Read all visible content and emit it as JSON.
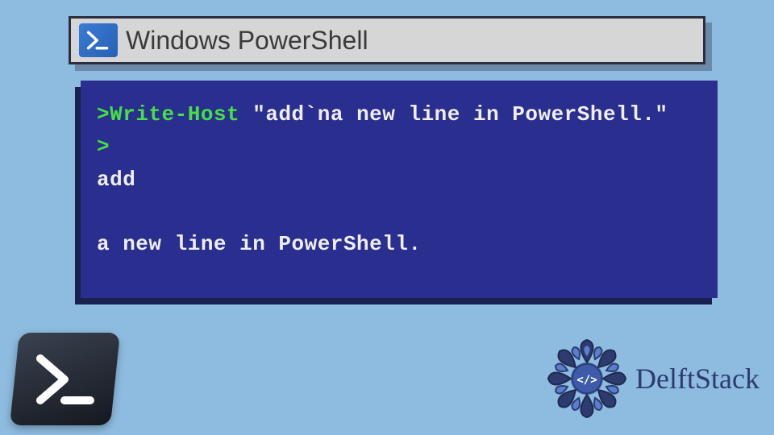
{
  "window": {
    "title": "Windows PowerShell"
  },
  "terminal": {
    "prompt1": ">",
    "command": "Write-Host",
    "string": " \"add`na new line in PowerShell.\"",
    "prompt2": ">",
    "out1": "add",
    "out_blank": " ",
    "out2": "a new line in PowerShell."
  },
  "branding": {
    "name": "DelftStack"
  },
  "colors": {
    "bg": "#8ebce0",
    "terminal_bg": "#2a2e8e",
    "prompt": "#44e044",
    "text": "#eeeeee",
    "brand": "#2d3b6f"
  }
}
